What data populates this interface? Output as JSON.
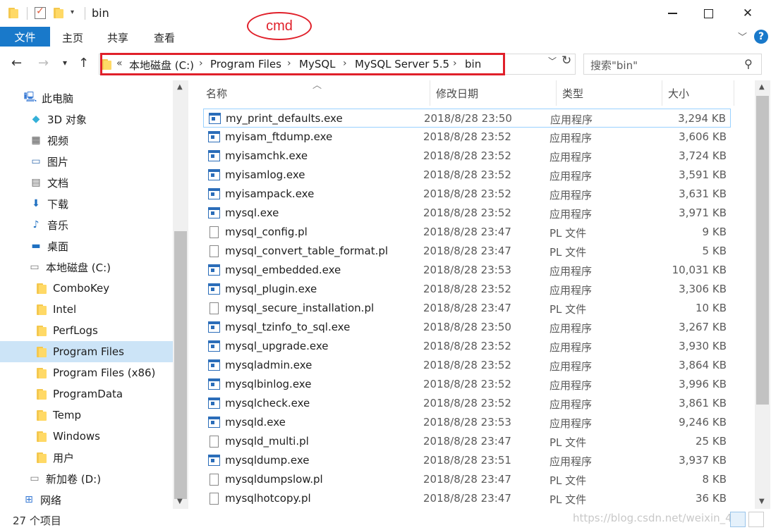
{
  "titlebar": {
    "title": "bin",
    "annotation": "cmd"
  },
  "ribbon": {
    "tabs": [
      "文件",
      "主页",
      "共享",
      "查看"
    ]
  },
  "address": {
    "overflow": "«",
    "parts": [
      "本地磁盘 (C:)",
      "Program Files",
      "MySQL",
      "MySQL Server 5.5",
      "bin"
    ]
  },
  "search": {
    "placeholder": "搜索\"bin\""
  },
  "sidebar": {
    "items": [
      {
        "label": "此电脑",
        "icon": "pc-icon"
      },
      {
        "label": "3D 对象",
        "icon": "cube-icon"
      },
      {
        "label": "视频",
        "icon": "video-icon"
      },
      {
        "label": "图片",
        "icon": "picture-icon"
      },
      {
        "label": "文档",
        "icon": "document-icon"
      },
      {
        "label": "下载",
        "icon": "download-icon"
      },
      {
        "label": "音乐",
        "icon": "music-icon"
      },
      {
        "label": "桌面",
        "icon": "desktop-icon"
      },
      {
        "label": "本地磁盘 (C:)",
        "icon": "drive-icon"
      },
      {
        "label": "ComboKey",
        "icon": "folder-icon"
      },
      {
        "label": "Intel",
        "icon": "folder-icon"
      },
      {
        "label": "PerfLogs",
        "icon": "folder-icon"
      },
      {
        "label": "Program Files",
        "icon": "folder-icon"
      },
      {
        "label": "Program Files (x86)",
        "icon": "folder-icon"
      },
      {
        "label": "ProgramData",
        "icon": "folder-icon"
      },
      {
        "label": "Temp",
        "icon": "folder-icon"
      },
      {
        "label": "Windows",
        "icon": "folder-icon"
      },
      {
        "label": "用户",
        "icon": "folder-icon"
      },
      {
        "label": "新加卷 (D:)",
        "icon": "drive-icon"
      },
      {
        "label": "网络",
        "icon": "network-icon"
      }
    ]
  },
  "columns": {
    "name": "名称",
    "date": "修改日期",
    "type": "类型",
    "size": "大小"
  },
  "files": [
    {
      "name": "my_print_defaults.exe",
      "date": "2018/8/28 23:50",
      "type": "应用程序",
      "size": "3,294 KB",
      "kind": "exe"
    },
    {
      "name": "myisam_ftdump.exe",
      "date": "2018/8/28 23:52",
      "type": "应用程序",
      "size": "3,606 KB",
      "kind": "exe"
    },
    {
      "name": "myisamchk.exe",
      "date": "2018/8/28 23:52",
      "type": "应用程序",
      "size": "3,724 KB",
      "kind": "exe"
    },
    {
      "name": "myisamlog.exe",
      "date": "2018/8/28 23:52",
      "type": "应用程序",
      "size": "3,591 KB",
      "kind": "exe"
    },
    {
      "name": "myisampack.exe",
      "date": "2018/8/28 23:52",
      "type": "应用程序",
      "size": "3,631 KB",
      "kind": "exe"
    },
    {
      "name": "mysql.exe",
      "date": "2018/8/28 23:52",
      "type": "应用程序",
      "size": "3,971 KB",
      "kind": "exe"
    },
    {
      "name": "mysql_config.pl",
      "date": "2018/8/28 23:47",
      "type": "PL 文件",
      "size": "9 KB",
      "kind": "pl"
    },
    {
      "name": "mysql_convert_table_format.pl",
      "date": "2018/8/28 23:47",
      "type": "PL 文件",
      "size": "5 KB",
      "kind": "pl"
    },
    {
      "name": "mysql_embedded.exe",
      "date": "2018/8/28 23:53",
      "type": "应用程序",
      "size": "10,031 KB",
      "kind": "exe"
    },
    {
      "name": "mysql_plugin.exe",
      "date": "2018/8/28 23:52",
      "type": "应用程序",
      "size": "3,306 KB",
      "kind": "exe"
    },
    {
      "name": "mysql_secure_installation.pl",
      "date": "2018/8/28 23:47",
      "type": "PL 文件",
      "size": "10 KB",
      "kind": "pl"
    },
    {
      "name": "mysql_tzinfo_to_sql.exe",
      "date": "2018/8/28 23:50",
      "type": "应用程序",
      "size": "3,267 KB",
      "kind": "exe"
    },
    {
      "name": "mysql_upgrade.exe",
      "date": "2018/8/28 23:52",
      "type": "应用程序",
      "size": "3,930 KB",
      "kind": "exe"
    },
    {
      "name": "mysqladmin.exe",
      "date": "2018/8/28 23:52",
      "type": "应用程序",
      "size": "3,864 KB",
      "kind": "exe"
    },
    {
      "name": "mysqlbinlog.exe",
      "date": "2018/8/28 23:52",
      "type": "应用程序",
      "size": "3,996 KB",
      "kind": "exe"
    },
    {
      "name": "mysqlcheck.exe",
      "date": "2018/8/28 23:52",
      "type": "应用程序",
      "size": "3,861 KB",
      "kind": "exe"
    },
    {
      "name": "mysqld.exe",
      "date": "2018/8/28 23:53",
      "type": "应用程序",
      "size": "9,246 KB",
      "kind": "exe"
    },
    {
      "name": "mysqld_multi.pl",
      "date": "2018/8/28 23:47",
      "type": "PL 文件",
      "size": "25 KB",
      "kind": "pl"
    },
    {
      "name": "mysqldump.exe",
      "date": "2018/8/28 23:51",
      "type": "应用程序",
      "size": "3,937 KB",
      "kind": "exe"
    },
    {
      "name": "mysqldumpslow.pl",
      "date": "2018/8/28 23:47",
      "type": "PL 文件",
      "size": "8 KB",
      "kind": "pl"
    },
    {
      "name": "mysqlhotcopy.pl",
      "date": "2018/8/28 23:47",
      "type": "PL 文件",
      "size": "36 KB",
      "kind": "pl"
    }
  ],
  "status": {
    "count": "27 个项目",
    "watermark": "https://blog.csdn.net/weixin_45"
  }
}
